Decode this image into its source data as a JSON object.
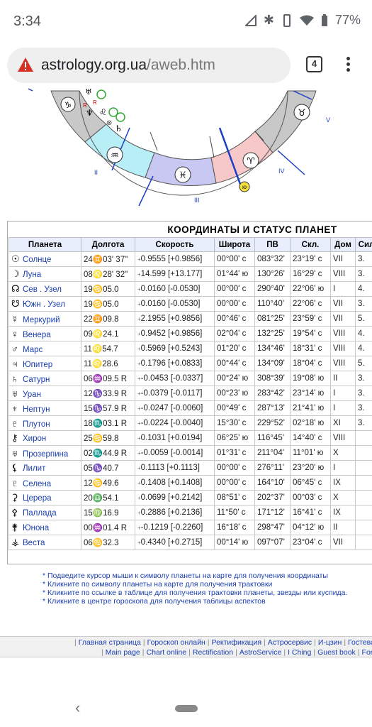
{
  "status": {
    "time": "3:34",
    "battery": "77%"
  },
  "browser": {
    "url_domain": "astrology.org.ua",
    "url_path": "/aweb.htm",
    "tab_count": "4"
  },
  "chart_labels": {
    "house_2": "II",
    "house_3": "III",
    "house_4": "IV",
    "house_5": "V",
    "retro": "R",
    "ju": "ю"
  },
  "table": {
    "title": "КООРДИНАТЫ  И  СТАТУС  ПЛАНЕТ",
    "headers": [
      "Планета",
      "Долгота",
      "Скорость",
      "Широта",
      "ПВ",
      "Скл.",
      "Дом",
      "Сил"
    ],
    "rows": [
      {
        "glyph": "☉",
        "name": "Солнце",
        "lon": "24♊03' 37\"",
        "speed": "0.9555 [+0.9856]",
        "lat": "00°00' с",
        "ra": "083°32'",
        "decl": "23°19' с",
        "house": "VII",
        "power": "3."
      },
      {
        "glyph": "☽",
        "name": "Луна",
        "lon": "08♌28' 32\"",
        "speed": "14.599 [+13.177]",
        "lat": "01°44' ю",
        "ra": "130°26'",
        "decl": "16°29' с",
        "house": "VIII",
        "power": "3."
      },
      {
        "glyph": "☊",
        "name": "Сев . Узел",
        "lon": "19♋05.0",
        "speed": "0.0160 [-0.0530]",
        "lat": "00°00' с",
        "ra": "290°40'",
        "decl": "22°06' ю",
        "house": "I",
        "power": "4."
      },
      {
        "glyph": "☋",
        "name": "Южн . Узел",
        "lon": "19♋05.0",
        "speed": "0.0160 [-0.0530]",
        "lat": "00°00' с",
        "ra": "110°40'",
        "decl": "22°06' с",
        "house": "VII",
        "power": "3."
      },
      {
        "glyph": "☿",
        "name": "Меркурий",
        "lon": "22♊09.8",
        "speed": "2.1955 [+0.9856]",
        "lat": "00°46' с",
        "ra": "081°25'",
        "decl": "23°59' с",
        "house": "VII",
        "power": "5."
      },
      {
        "glyph": "♀",
        "name": "Венера",
        "lon": "09♌24.1",
        "speed": "0.9452 [+0.9856]",
        "lat": "02°04' с",
        "ra": "132°25'",
        "decl": "19°54' с",
        "house": "VIII",
        "power": "4."
      },
      {
        "glyph": "♂",
        "name": "Марс",
        "lon": "11♌54.7",
        "speed": "0.5969 [+0.5243]",
        "lat": "01°20' с",
        "ra": "134°46'",
        "decl": "18°31' с",
        "house": "VIII",
        "power": "4."
      },
      {
        "glyph": "♃",
        "name": "Юпитер",
        "lon": "11♌28.6",
        "speed": "0.1796 [+0.0833]",
        "lat": "00°44' с",
        "ra": "134°09'",
        "decl": "18°04' с",
        "house": "VIII",
        "power": "5."
      },
      {
        "glyph": "♄",
        "name": "Сатурн",
        "lon": "06♒09.5  R",
        "speed": "-0.0453 [-0.0337]",
        "lat": "00°24' ю",
        "ra": "308°39'",
        "decl": "19°08' ю",
        "house": "II",
        "power": "3."
      },
      {
        "glyph": "♅",
        "name": "Уран",
        "lon": "12♑33.9  R",
        "speed": "-0.0379 [-0.0117]",
        "lat": "00°23' ю",
        "ra": "283°42'",
        "decl": "23°14' ю",
        "house": "I",
        "power": "3."
      },
      {
        "glyph": "♆",
        "name": "Нептун",
        "lon": "15♑57.9  R",
        "speed": "-0.0247 [-0.0060]",
        "lat": "00°49' с",
        "ra": "287°13'",
        "decl": "21°41' ю",
        "house": "I",
        "power": "3."
      },
      {
        "glyph": "♇",
        "name": "Плутон",
        "lon": "18♏03.1  R",
        "speed": "-0.0224 [-0.0040]",
        "lat": "15°30' с",
        "ra": "229°52'",
        "decl": "02°18' ю",
        "house": "XI",
        "power": "3."
      },
      {
        "glyph": "⚷",
        "name": "Хирон",
        "lon": "25♋59.8",
        "speed": "0.1031 [+0.0194]",
        "lat": "06°25' ю",
        "ra": "116°45'",
        "decl": "14°40' с",
        "house": "VIII",
        "power": ""
      },
      {
        "glyph": "♅",
        "name": "Прозерпина",
        "lon": "02♏44.9  R",
        "speed": "-0.0059 [-0.0014]",
        "lat": "01°31' с",
        "ra": "211°04'",
        "decl": "11°01' ю",
        "house": "X",
        "power": ""
      },
      {
        "glyph": "⚸",
        "name": "Лилит",
        "lon": "05♑40.7",
        "speed": "0.1113 [+0.1113]",
        "lat": "00°00' с",
        "ra": "276°11'",
        "decl": "23°20' ю",
        "house": "I",
        "power": ""
      },
      {
        "glyph": "♇",
        "name": "Селена",
        "lon": "12♋49.6",
        "speed": "0.1408 [+0.1408]",
        "lat": "00°00' с",
        "ra": "164°10'",
        "decl": "06°45' с",
        "house": "IX",
        "power": ""
      },
      {
        "glyph": "⚳",
        "name": "Церера",
        "lon": "20♎54.1",
        "speed": "0.0699 [+0.2142]",
        "lat": "08°51' с",
        "ra": "202°37'",
        "decl": "00°03' с",
        "house": "X",
        "power": ""
      },
      {
        "glyph": "⚴",
        "name": "Паллада",
        "lon": "15♍16.9",
        "speed": "0.2886 [+0.2136]",
        "lat": "11°50' с",
        "ra": "171°12'",
        "decl": "16°41' с",
        "house": "IX",
        "power": ""
      },
      {
        "glyph": "⚵",
        "name": "Юнона",
        "lon": "00♒01.4  R",
        "speed": "-0.1219 [-0.2260]",
        "lat": "16°18' с",
        "ra": "298°47'",
        "decl": "04°12' ю",
        "house": "II",
        "power": ""
      },
      {
        "glyph": "⚶",
        "name": "Веста",
        "lon": "06♋32.3",
        "speed": "0.4340 [+0.2715]",
        "lat": "00°14' ю",
        "ra": "097°07'",
        "decl": "23°04' с",
        "house": "VII",
        "power": ""
      }
    ]
  },
  "notes": [
    "* Подведите курсор мыши к символу планеты на карте для получения координаты",
    "* Кликните по символу планеты на карте для получения трактовки",
    "* Кликните по ссылке в таблице для получения трактовки планеты, звезды или куспида.",
    "* Кликните в центре гороскопа для получения таблицы аспектов"
  ],
  "footer": {
    "ru_links": [
      "Главная страница",
      "Гороскоп онлайн",
      "Ректификация",
      "Астросервис",
      "И-цзин",
      "Гостева"
    ],
    "en_links": [
      "Main page",
      "Chart online",
      "Rectification",
      "AstroService",
      "I Ching",
      "Guest book",
      "Forum"
    ]
  }
}
